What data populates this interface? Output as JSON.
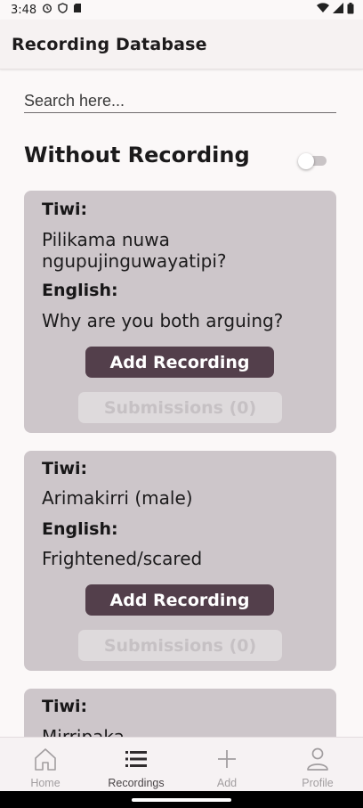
{
  "status_bar": {
    "time": "3:48",
    "icons": [
      "alarm-icon",
      "shield-icon",
      "sd-card-icon",
      "wifi-icon",
      "signal-icon",
      "battery-icon"
    ]
  },
  "app_bar": {
    "title": "Recording Database"
  },
  "search": {
    "placeholder": "Search here...",
    "value": ""
  },
  "filter": {
    "label": "Without Recording",
    "toggle_on": false
  },
  "cards": [
    {
      "tiwi_label": "Tiwi:",
      "tiwi_text": "Pilikama nuwa ngupujinguwayatipi?",
      "english_label": "English:",
      "english_text": "Why are you both arguing?",
      "add_label": "Add Recording",
      "submissions_label": "Submissions (0)"
    },
    {
      "tiwi_label": "Tiwi:",
      "tiwi_text": "Arimakirri (male)",
      "english_label": "English:",
      "english_text": "Frightened/scared",
      "add_label": "Add Recording",
      "submissions_label": "Submissions (0)"
    },
    {
      "tiwi_label": "Tiwi:",
      "tiwi_text": "Mirripaka"
    }
  ],
  "bottom_nav": {
    "items": [
      {
        "label": "Home",
        "icon": "home-icon"
      },
      {
        "label": "Recordings",
        "icon": "list-icon",
        "active": true
      },
      {
        "label": "Add",
        "icon": "plus-icon"
      },
      {
        "label": "Profile",
        "icon": "person-icon"
      }
    ]
  },
  "colors": {
    "card_bg": "#cdc6ca",
    "primary_button": "#533f4b",
    "disabled_button": "#dedadc",
    "background": "#fbf8f8"
  }
}
